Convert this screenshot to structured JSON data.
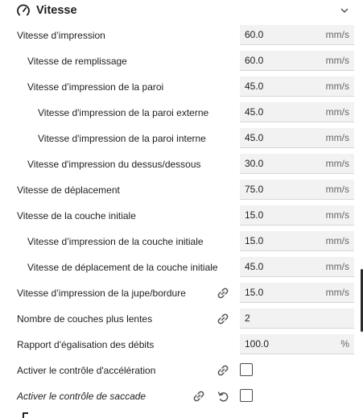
{
  "header": {
    "title": "Vitesse",
    "icon": "gauge-icon",
    "collapse_icon": "chevron-down-icon"
  },
  "settings": [
    {
      "label": "Vitesse d’impression",
      "value": "60.0",
      "unit": "mm/s"
    },
    {
      "label": "Vitesse de remplissage",
      "value": "60.0",
      "unit": "mm/s"
    },
    {
      "label": "Vitesse d’impression de la paroi",
      "value": "45.0",
      "unit": "mm/s"
    },
    {
      "label": "Vitesse d'impression de la paroi externe",
      "value": "45.0",
      "unit": "mm/s"
    },
    {
      "label": "Vitesse d'impression de la paroi interne",
      "value": "45.0",
      "unit": "mm/s"
    },
    {
      "label": "Vitesse d'impression du dessus/dessous",
      "value": "30.0",
      "unit": "mm/s"
    },
    {
      "label": "Vitesse de déplacement",
      "value": "75.0",
      "unit": "mm/s"
    },
    {
      "label": "Vitesse de la couche initiale",
      "value": "15.0",
      "unit": "mm/s"
    },
    {
      "label": "Vitesse d’impression de la couche initiale",
      "value": "15.0",
      "unit": "mm/s"
    },
    {
      "label": "Vitesse de déplacement de la couche initiale",
      "value": "45.0",
      "unit": "mm/s"
    },
    {
      "label": "Vitesse d’impression de la jupe/bordure",
      "value": "15.0",
      "unit": "mm/s"
    },
    {
      "label": "Nombre de couches plus lentes",
      "value": "2",
      "unit": ""
    },
    {
      "label": "Rapport d'égalisation des débits",
      "value": "100.0",
      "unit": "%"
    },
    {
      "label": "Activer le contrôle d'accélération",
      "checked": false
    },
    {
      "label": "Activer le contrôle de saccade",
      "checked": false
    }
  ],
  "colors": {
    "field_bg": "#f2f2f2",
    "text": "#1e1e1e",
    "unit": "#666666"
  }
}
